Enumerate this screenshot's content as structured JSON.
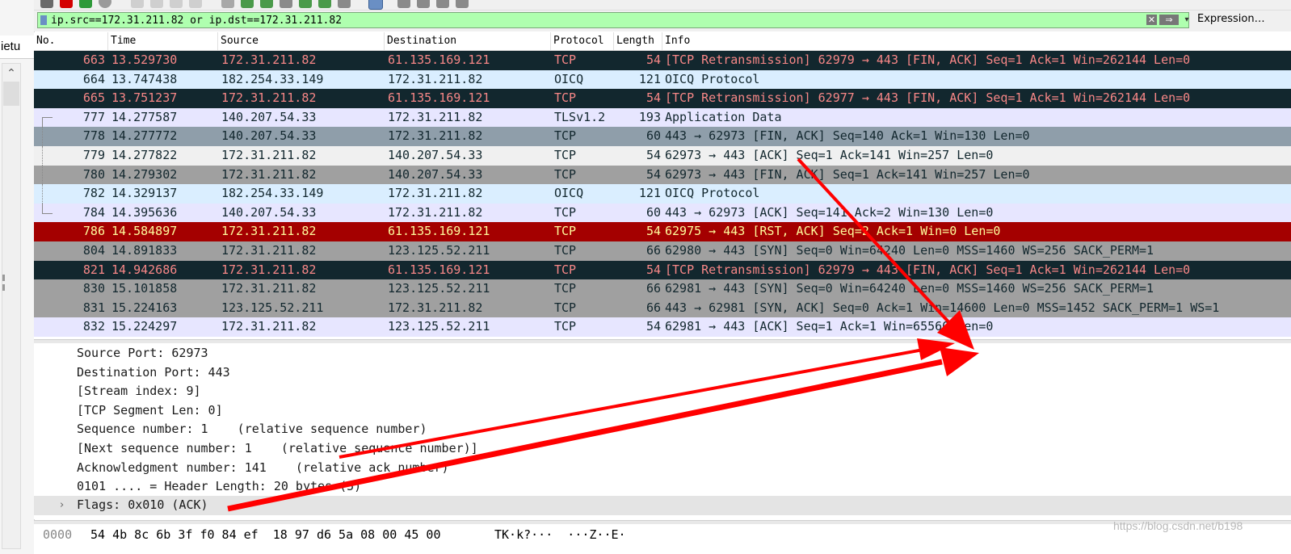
{
  "left_panel": {
    "tab_label": "ietu"
  },
  "filter": {
    "value": "ip.src==172.31.211.82 or ip.dst==172.31.211.82",
    "clear_glyph": "✕",
    "apply_glyph": "⇒",
    "dropdown_glyph": "▾",
    "expression_label": "Expression…"
  },
  "packet_list": {
    "columns": {
      "no": "No.",
      "time": "Time",
      "source": "Source",
      "destination": "Destination",
      "protocol": "Protocol",
      "length": "Length",
      "info": "Info"
    },
    "rows": [
      {
        "no": "663",
        "time": "13.529730",
        "source": "172.31.211.82",
        "destination": "61.135.169.121",
        "protocol": "TCP",
        "length": "54",
        "info": "[TCP Retransmission] 62979 → 443 [FIN, ACK] Seq=1 Ack=1 Win=262144 Len=0"
      },
      {
        "no": "664",
        "time": "13.747438",
        "source": "182.254.33.149",
        "destination": "172.31.211.82",
        "protocol": "OICQ",
        "length": "121",
        "info": "OICQ Protocol"
      },
      {
        "no": "665",
        "time": "13.751237",
        "source": "172.31.211.82",
        "destination": "61.135.169.121",
        "protocol": "TCP",
        "length": "54",
        "info": "[TCP Retransmission] 62977 → 443 [FIN, ACK] Seq=1 Ack=1 Win=262144 Len=0"
      },
      {
        "no": "777",
        "time": "14.277587",
        "source": "140.207.54.33",
        "destination": "172.31.211.82",
        "protocol": "TLSv1.2",
        "length": "193",
        "info": "Application Data"
      },
      {
        "no": "778",
        "time": "14.277772",
        "source": "140.207.54.33",
        "destination": "172.31.211.82",
        "protocol": "TCP",
        "length": "60",
        "info": "443 → 62973 [FIN, ACK] Seq=140 Ack=1 Win=130 Len=0"
      },
      {
        "no": "779",
        "time": "14.277822",
        "source": "172.31.211.82",
        "destination": "140.207.54.33",
        "protocol": "TCP",
        "length": "54",
        "info": "62973 → 443 [ACK] Seq=1 Ack=141 Win=257 Len=0"
      },
      {
        "no": "780",
        "time": "14.279302",
        "source": "172.31.211.82",
        "destination": "140.207.54.33",
        "protocol": "TCP",
        "length": "54",
        "info": "62973 → 443 [FIN, ACK] Seq=1 Ack=141 Win=257 Len=0"
      },
      {
        "no": "782",
        "time": "14.329137",
        "source": "182.254.33.149",
        "destination": "172.31.211.82",
        "protocol": "OICQ",
        "length": "121",
        "info": "OICQ Protocol"
      },
      {
        "no": "784",
        "time": "14.395636",
        "source": "140.207.54.33",
        "destination": "172.31.211.82",
        "protocol": "TCP",
        "length": "60",
        "info": "443 → 62973 [ACK] Seq=141 Ack=2 Win=130 Len=0"
      },
      {
        "no": "786",
        "time": "14.584897",
        "source": "172.31.211.82",
        "destination": "61.135.169.121",
        "protocol": "TCP",
        "length": "54",
        "info": "62975 → 443 [RST, ACK] Seq=2 Ack=1 Win=0 Len=0"
      },
      {
        "no": "804",
        "time": "14.891833",
        "source": "172.31.211.82",
        "destination": "123.125.52.211",
        "protocol": "TCP",
        "length": "66",
        "info": "62980 → 443 [SYN] Seq=0 Win=64240 Len=0 MSS=1460 WS=256 SACK_PERM=1"
      },
      {
        "no": "821",
        "time": "14.942686",
        "source": "172.31.211.82",
        "destination": "61.135.169.121",
        "protocol": "TCP",
        "length": "54",
        "info": "[TCP Retransmission] 62979 → 443 [FIN, ACK] Seq=1 Ack=1 Win=262144 Len=0"
      },
      {
        "no": "830",
        "time": "15.101858",
        "source": "172.31.211.82",
        "destination": "123.125.52.211",
        "protocol": "TCP",
        "length": "66",
        "info": "62981 → 443 [SYN] Seq=0 Win=64240 Len=0 MSS=1460 WS=256 SACK_PERM=1"
      },
      {
        "no": "831",
        "time": "15.224163",
        "source": "123.125.52.211",
        "destination": "172.31.211.82",
        "protocol": "TCP",
        "length": "66",
        "info": "443 → 62981 [SYN, ACK] Seq=0 Ack=1 Win=14600 Len=0 MSS=1452 SACK_PERM=1 WS=1"
      },
      {
        "no": "832",
        "time": "15.224297",
        "source": "172.31.211.82",
        "destination": "123.125.52.211",
        "protocol": "TCP",
        "length": "54",
        "info": "62981 → 443 [ACK] Seq=1 Ack=1 Win=65560 Len=0"
      }
    ]
  },
  "details": {
    "lines": [
      "Source Port: 62973",
      "Destination Port: 443",
      "[Stream index: 9]",
      "[TCP Segment Len: 0]",
      "Sequence number: 1    (relative sequence number)",
      "[Next sequence number: 1    (relative sequence number)]",
      "Acknowledgment number: 141    (relative ack number)",
      "0101 .... = Header Length: 20 bytes (5)"
    ],
    "flags_expand_glyph": "›",
    "flags_label": "Flags: 0x010 (ACK)"
  },
  "hex": {
    "offset": "0000",
    "bytes": "54 4b 8c 6b 3f f0 84 ef  18 97 d6 5a 08 00 45 00",
    "ascii": "TK·k?···  ···Z··E·"
  },
  "watermark": "https://blog.csdn.net/b198",
  "colors": {
    "annotation_arrow": "#ff0000",
    "filter_valid_bg": "#afffaf",
    "tcp_error_bg": "#12272e",
    "tcp_error_fg": "#f78787",
    "rst_bg": "#a40000",
    "rst_fg": "#fffc9c"
  }
}
